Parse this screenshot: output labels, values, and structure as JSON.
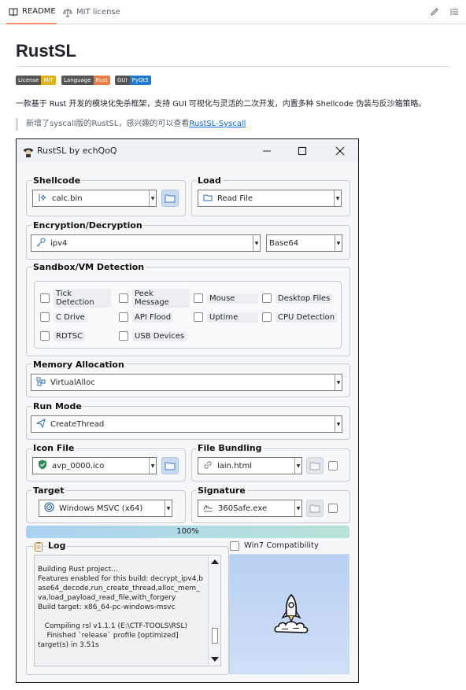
{
  "tabs": {
    "readme": "README",
    "license": "MIT license"
  },
  "readme": {
    "title": "RustSL",
    "badges": [
      {
        "label": "License",
        "value": "MIT",
        "color": "#dfb317"
      },
      {
        "label": "Language",
        "value": "Rust",
        "color": "#e87e43"
      },
      {
        "label": "GUI",
        "value": "PyQt5",
        "color": "#1f7bd1"
      }
    ],
    "description": "一款基于 Rust 开发的模块化免杀框架，支持 GUI 可视化与灵活的二次开发，内置多种 Shellcode 伪装与反沙箱策略。",
    "quote_text": "新增了syscall版的RustSL，感兴趣的可以查看",
    "quote_link": "RustSL-Syscall"
  },
  "window": {
    "title": "RustSL by echQoQ",
    "shellcode": {
      "title": "Shellcode",
      "value": "calc.bin"
    },
    "load": {
      "title": "Load",
      "value": "Read File"
    },
    "encryption": {
      "title": "Encryption/Decryption",
      "value": "ipv4",
      "encoding": "Base64"
    },
    "sandbox": {
      "title": "Sandbox/VM Detection",
      "options": [
        "Tick Detection",
        "Peek Message",
        "Mouse",
        "Desktop Files",
        "C Drive",
        "API Flood",
        "Uptime",
        "CPU Detection",
        "RDTSC",
        "USB Devices"
      ]
    },
    "memory": {
      "title": "Memory Allocation",
      "value": "VirtualAlloc"
    },
    "run_mode": {
      "title": "Run Mode",
      "value": "CreateThread"
    },
    "icon_file": {
      "title": "Icon File",
      "value": "avp_0000.ico"
    },
    "bundling": {
      "title": "File Bundling",
      "value": "lain.html"
    },
    "target": {
      "title": "Target",
      "value": "Windows MSVC (x64)"
    },
    "signature": {
      "title": "Signature",
      "value": "360Safe.exe"
    },
    "progress": {
      "value": 100,
      "label": "100%"
    },
    "win7": "Win7 Compatibility",
    "log": {
      "title": "Log",
      "text": "Building Rust project...\nFeatures enabled for this build: decrypt_ipv4,base64_decode,run_create_thread,alloc_mem_va,load_payload_read_file,with_forgery\nBuild target: x86_64-pc-windows-msvc\n\n   Compiling rsl v1.1.1 (E:\\CTF-TOOLS\\RSL)\n    Finished `release` profile [optimized]\ntarget(s) in 3.51s"
    }
  }
}
